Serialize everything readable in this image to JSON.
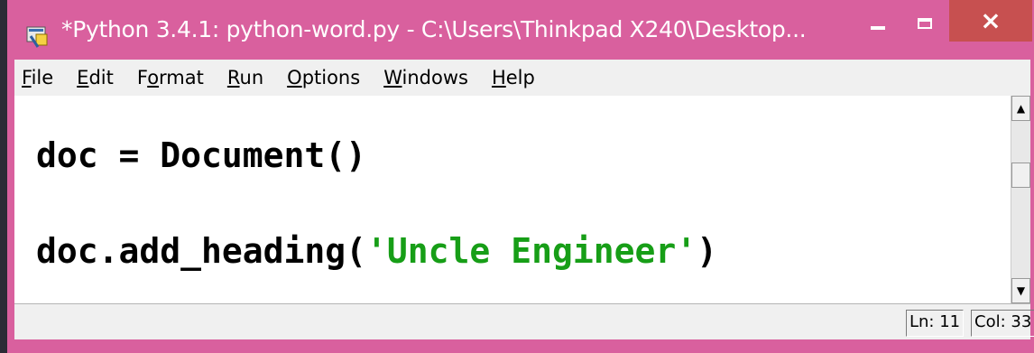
{
  "window": {
    "title": "*Python 3.4.1: python-word.py - C:\\Users\\Thinkpad X240\\Desktop...",
    "app_icon": "python-idle-icon",
    "controls": {
      "minimize": "−",
      "maximize": "□",
      "close": "×"
    },
    "frame_color": "#d9609e",
    "close_color": "#c75050"
  },
  "menubar": {
    "items": [
      {
        "accel": "F",
        "rest": "ile"
      },
      {
        "accel": "E",
        "rest": "dit"
      },
      {
        "pre": "F",
        "accel": "o",
        "rest": "rmat"
      },
      {
        "accel": "R",
        "rest": "un"
      },
      {
        "accel": "O",
        "rest": "ptions"
      },
      {
        "accel": "W",
        "rest": "indows"
      },
      {
        "accel": "H",
        "rest": "elp"
      }
    ]
  },
  "editor": {
    "line1": "doc = Document()",
    "line2_prefix": "doc.add_heading(",
    "line2_string": "'Uncle Engineer'",
    "line2_suffix": ")",
    "string_color": "#179e17"
  },
  "statusbar": {
    "ln": "Ln: 11",
    "col": "Col: 33"
  }
}
